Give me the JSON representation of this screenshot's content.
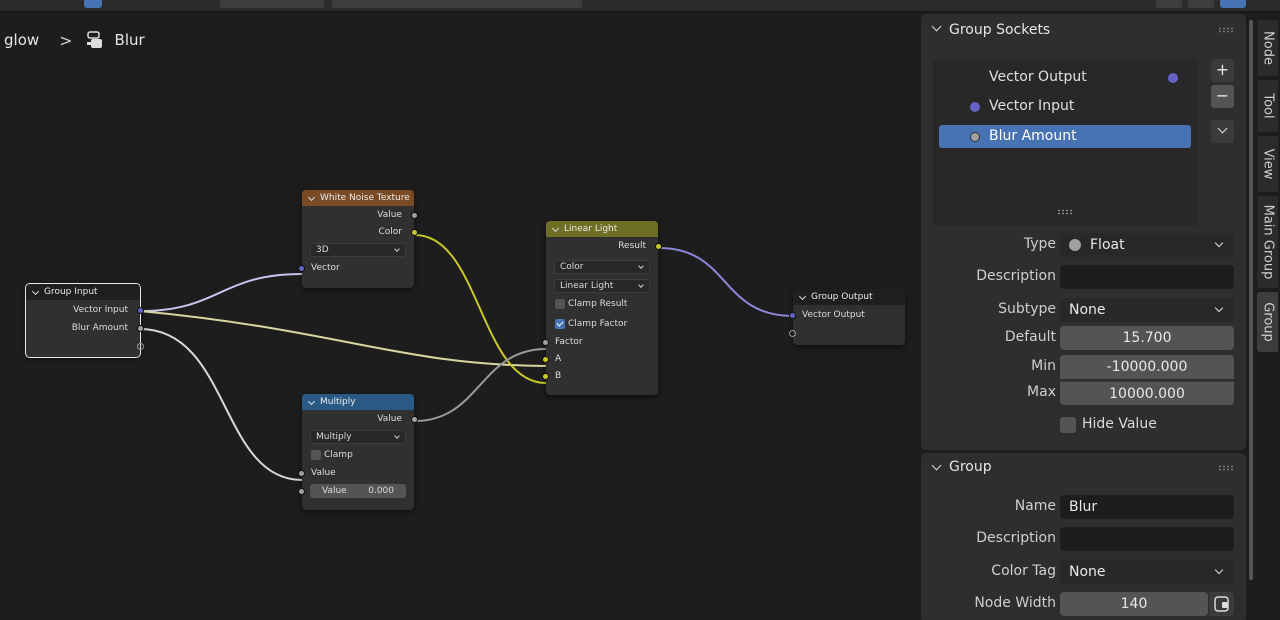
{
  "breadcrumb": {
    "parent": "glow",
    "current": "Blur"
  },
  "nodes": {
    "group_input": {
      "title": "Group Input",
      "outputs": [
        "Vector Input",
        "Blur Amount"
      ]
    },
    "white_noise": {
      "title": "White Noise Texture",
      "outputs": [
        "Value",
        "Color"
      ],
      "dimension": "3D",
      "input": "Vector"
    },
    "multiply": {
      "title": "Multiply",
      "output": "Value",
      "operation": "Multiply",
      "clamp_label": "Clamp",
      "input": "Value",
      "value_label": "Value",
      "value": "0.000"
    },
    "linear_light": {
      "title": "Linear Light",
      "output": "Result",
      "data_type": "Color",
      "blend_mode": "Linear Light",
      "clamp_result": "Clamp Result",
      "clamp_factor": "Clamp Factor",
      "inputs": [
        "Factor",
        "A",
        "B"
      ]
    },
    "group_output": {
      "title": "Group Output",
      "input": "Vector Output"
    }
  },
  "group_sockets_panel": {
    "title": "Group Sockets",
    "sockets": [
      {
        "name": "Vector Output",
        "kind": "output"
      },
      {
        "name": "Vector Input",
        "kind": "input"
      },
      {
        "name": "Blur Amount",
        "kind": "input",
        "active": true
      }
    ],
    "add_icon": "+",
    "remove_icon": "−",
    "type_label": "Type",
    "type_value": "Float",
    "description_label": "Description",
    "description_value": "",
    "subtype_label": "Subtype",
    "subtype_value": "None",
    "default_label": "Default",
    "default_value": "15.700",
    "min_label": "Min",
    "min_value": "-10000.000",
    "max_label": "Max",
    "max_value": "10000.000",
    "hide_value_label": "Hide Value"
  },
  "group_panel": {
    "title": "Group",
    "name_label": "Name",
    "name_value": "Blur",
    "description_label": "Description",
    "description_value": "",
    "color_tag_label": "Color Tag",
    "color_tag_value": "None",
    "node_width_label": "Node Width",
    "node_width_value": "140"
  },
  "tabs": [
    "Node",
    "Tool",
    "View",
    "Main Group",
    "Group"
  ],
  "colors": {
    "white_noise_header": "#7a4a24",
    "multiply_header": "#295a84",
    "linear_light_header": "#6e6e24",
    "output_header": "#1f1f1f",
    "accent": "#4772b3",
    "socket_vector": "#6363c7",
    "socket_color": "#c7c729",
    "socket_float": "#a1a1a1"
  }
}
